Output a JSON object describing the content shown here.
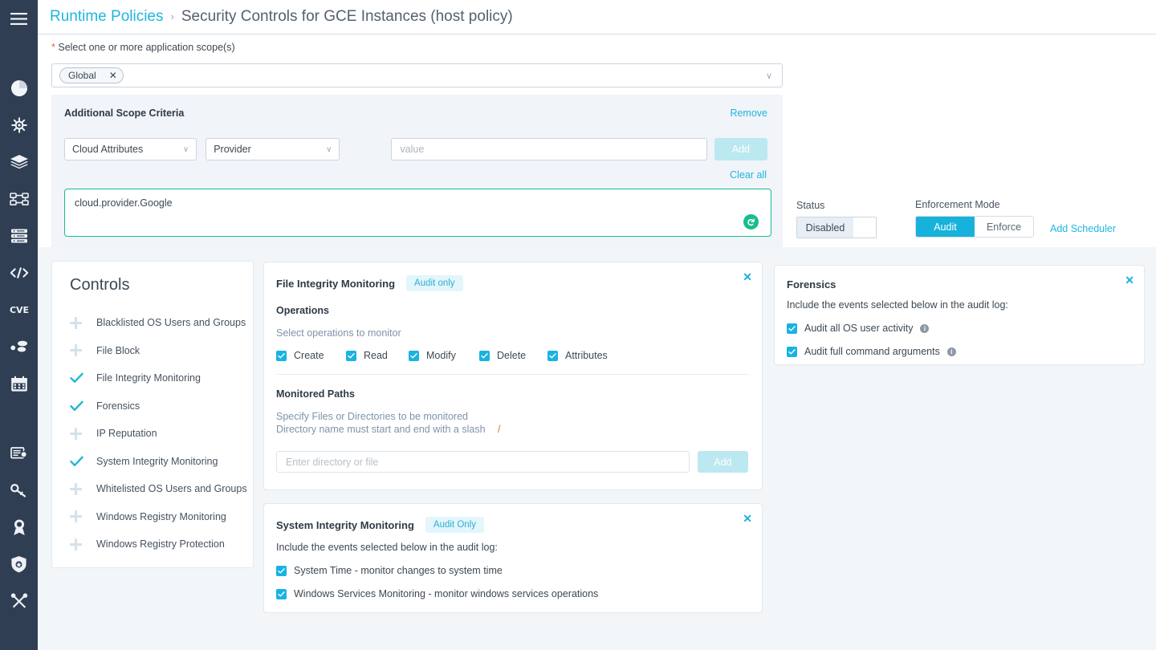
{
  "sidebar": {
    "items": [
      {
        "icon": "hamburger-menu-icon",
        "name": "menu-toggle"
      },
      {
        "icon": "pie-chart-icon",
        "name": "dashboard"
      },
      {
        "icon": "ship-helm-icon",
        "name": "navigator"
      },
      {
        "icon": "layers-icon",
        "name": "images"
      },
      {
        "icon": "workload-icon",
        "name": "workloads"
      },
      {
        "icon": "server-stack-icon",
        "name": "infrastructure"
      },
      {
        "icon": "code-brackets-icon",
        "name": "code-builds"
      },
      {
        "icon": "cve-icon",
        "name": "cve"
      },
      {
        "icon": "nodes-icon",
        "name": "risk-explorer"
      },
      {
        "icon": "calendar-icon",
        "name": "reports"
      },
      {
        "icon": "certificate-icon",
        "name": "compliance"
      },
      {
        "icon": "key-icon",
        "name": "secrets"
      },
      {
        "icon": "award-ribbon-icon",
        "name": "assurance"
      },
      {
        "icon": "shield-star-icon",
        "name": "policies"
      },
      {
        "icon": "tools-icon",
        "name": "administration"
      }
    ]
  },
  "header": {
    "breadcrumb_root": "Runtime Policies",
    "breadcrumb_separator": "›",
    "breadcrumb_current": "Security Controls for GCE Instances (host policy)"
  },
  "scope": {
    "required_mark": "*",
    "label": "Select one or more application scope(s)",
    "chip_label": "Global",
    "chip_remove": "✕",
    "dropdown_caret": "∨"
  },
  "criteria": {
    "title": "Additional Scope Criteria",
    "remove_label": "Remove",
    "attribute_select": "Cloud Attributes",
    "provider_select": "Provider",
    "value_placeholder": "value",
    "add_label": "Add",
    "clear_all_label": "Clear all",
    "expression": "cloud.provider.Google",
    "reset_icon": "reset-circle-icon"
  },
  "status": {
    "label": "Status",
    "value": "Disabled"
  },
  "enforcement": {
    "label": "Enforcement Mode",
    "options": [
      "Audit",
      "Enforce"
    ],
    "selected": "Audit",
    "add_scheduler_label": "Add Scheduler"
  },
  "controls": {
    "title": "Controls",
    "items": [
      {
        "label": "Blacklisted OS Users and Groups",
        "enabled": false
      },
      {
        "label": "File Block",
        "enabled": false
      },
      {
        "label": "File Integrity Monitoring",
        "enabled": true
      },
      {
        "label": "Forensics",
        "enabled": true
      },
      {
        "label": "IP Reputation",
        "enabled": false
      },
      {
        "label": "System Integrity Monitoring",
        "enabled": true
      },
      {
        "label": "Whitelisted OS Users and Groups",
        "enabled": false
      },
      {
        "label": "Windows Registry Monitoring",
        "enabled": false
      },
      {
        "label": "Windows Registry Protection",
        "enabled": false
      }
    ]
  },
  "fim_panel": {
    "title": "File Integrity Monitoring",
    "badge": "Audit only",
    "close": "✕",
    "operations_heading": "Operations",
    "operations_hint": "Select operations to monitor",
    "operations": [
      {
        "label": "Create",
        "checked": true
      },
      {
        "label": "Read",
        "checked": true
      },
      {
        "label": "Modify",
        "checked": true
      },
      {
        "label": "Delete",
        "checked": true
      },
      {
        "label": "Attributes",
        "checked": true
      }
    ],
    "paths_heading": "Monitored Paths",
    "paths_hint_1": "Specify Files or Directories to be monitored",
    "paths_hint_2": "Directory name must start and end with a slash",
    "paths_slash": "/",
    "path_placeholder": "Enter directory or file",
    "path_add_label": "Add"
  },
  "sim_panel": {
    "title": "System Integrity Monitoring",
    "badge": "Audit Only",
    "close": "✕",
    "description": "Include the events selected below in the audit log:",
    "events": [
      {
        "label": "System Time - monitor changes to system time",
        "checked": true
      },
      {
        "label": "Windows Services Monitoring - monitor windows services operations",
        "checked": true
      }
    ]
  },
  "forensics_panel": {
    "title": "Forensics",
    "close": "✕",
    "description": "Include the events selected below in the audit log:",
    "events": [
      {
        "label": "Audit all OS user activity",
        "checked": true,
        "info": "i"
      },
      {
        "label": "Audit full command arguments",
        "checked": true,
        "info": "i"
      }
    ]
  },
  "colors": {
    "accent_cyan": "#17b2dc",
    "link_cyan": "#1fb6e0",
    "sidebar_bg": "#2f3e53",
    "page_bg": "#f2f6f9",
    "expression_border_green": "#17bd8d",
    "required_orange": "#e8663c",
    "badge_bg": "#e2f6fc"
  }
}
